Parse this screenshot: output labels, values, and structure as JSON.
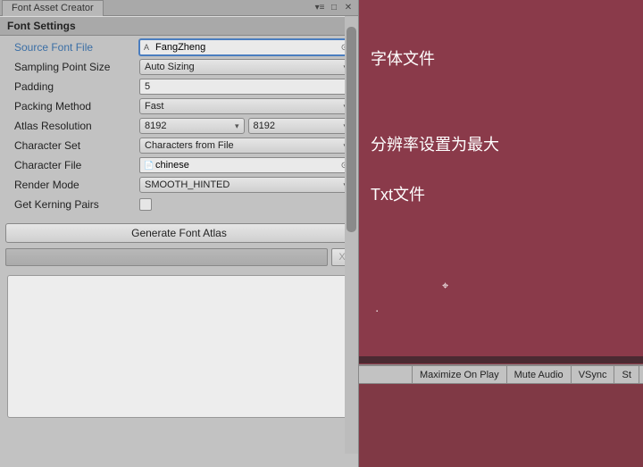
{
  "window": {
    "title": "Font Asset Creator"
  },
  "section": {
    "title": "Font Settings"
  },
  "labels": {
    "sourceFont": "Source Font File",
    "samplingPointSize": "Sampling Point Size",
    "padding": "Padding",
    "packingMethod": "Packing Method",
    "atlasResolution": "Atlas Resolution",
    "characterSet": "Character Set",
    "characterFile": "Character File",
    "renderMode": "Render Mode",
    "getKerningPairs": "Get Kerning Pairs"
  },
  "values": {
    "sourceFont": "FangZheng",
    "samplingPointSize": "Auto Sizing",
    "padding": "5",
    "packingMethod": "Fast",
    "atlasResolutionW": "8192",
    "atlasResolutionH": "8192",
    "characterSet": "Characters from File",
    "characterFile": "chinese",
    "renderMode": "SMOOTH_HINTED"
  },
  "buttons": {
    "generate": "Generate Font Atlas",
    "cancel": "X"
  },
  "annotations": {
    "a1": "字体文件",
    "a2": "分辨率设置为最大",
    "a3": "Txt文件"
  },
  "bottomBar": {
    "maximize": "Maximize On Play",
    "mute": "Mute Audio",
    "vsync": "VSync",
    "stats": "St"
  }
}
